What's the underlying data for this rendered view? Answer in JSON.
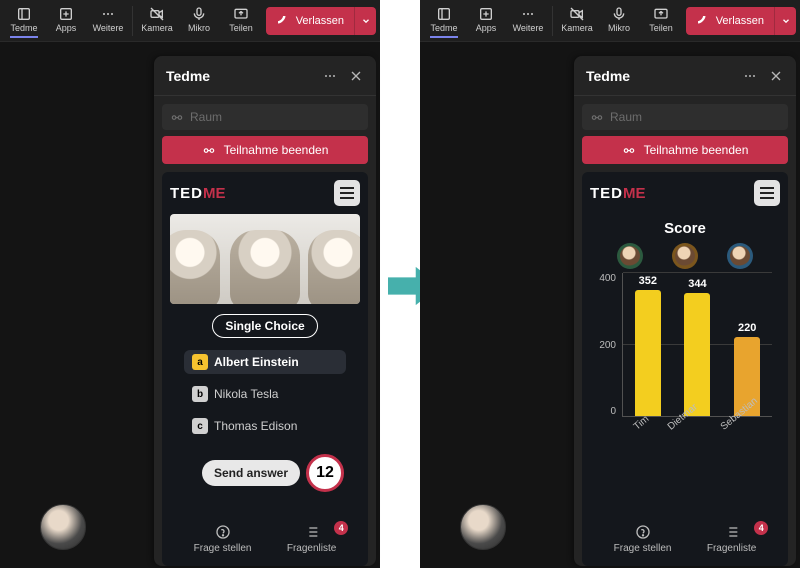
{
  "toolbar": {
    "items": [
      {
        "id": "tedme",
        "label": "Tedme"
      },
      {
        "id": "apps",
        "label": "Apps"
      },
      {
        "id": "weitere",
        "label": "Weitere"
      },
      {
        "id": "kamera",
        "label": "Kamera"
      },
      {
        "id": "mikro",
        "label": "Mikro"
      },
      {
        "id": "teilen",
        "label": "Teilen"
      }
    ],
    "leave_label": "Verlassen"
  },
  "panel": {
    "title": "Tedme",
    "raum_label": "Raum",
    "end_participation": "Teilnahme beenden",
    "tedme_logo_left": "TED",
    "tedme_logo_right": "ME",
    "bottom_tabs": {
      "ask": "Frage stellen",
      "list": "Fragenliste",
      "list_badge": "4"
    }
  },
  "quiz": {
    "type_label": "Single Choice",
    "answers": [
      {
        "letter": "a",
        "text": "Albert Einstein",
        "selected": true
      },
      {
        "letter": "b",
        "text": "Nikola Tesla",
        "selected": false
      },
      {
        "letter": "c",
        "text": "Thomas Edison",
        "selected": false
      }
    ],
    "send_label": "Send answer",
    "timer": "12"
  },
  "score": {
    "title": "Score"
  },
  "chart_data": {
    "type": "bar",
    "title": "Score",
    "categories": [
      "Tim",
      "Dietmar",
      "Sebastian"
    ],
    "values": [
      352,
      344,
      220
    ],
    "colors": [
      "#f3ce1f",
      "#f3ce1f",
      "#e8a42e"
    ],
    "ylabel": "",
    "xlabel": "",
    "ylim": [
      0,
      400
    ],
    "ticks": [
      0,
      200,
      400
    ]
  }
}
